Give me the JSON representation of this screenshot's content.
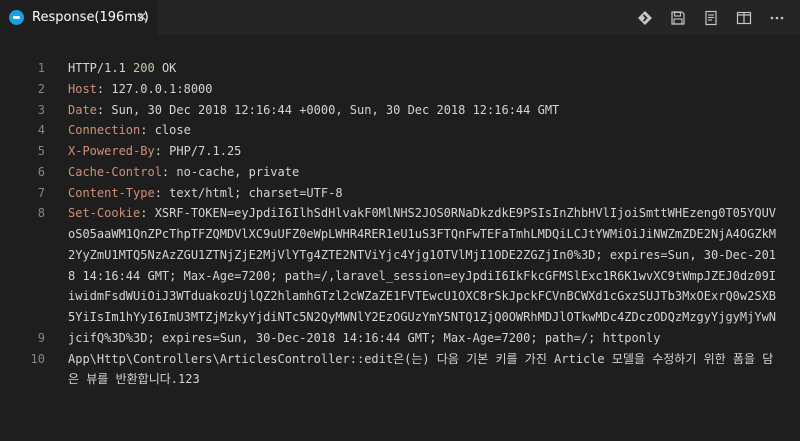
{
  "tab": {
    "title": "Response(196ms)",
    "close_glyph": "×",
    "icon": "rest-client-icon"
  },
  "toolbar": {
    "icons": [
      "diff-icon",
      "save-icon",
      "preview-icon",
      "split-editor-icon",
      "more-icon"
    ]
  },
  "lines": [
    {
      "n": "1",
      "parts": [
        {
          "t": "HTTP/1.1 "
        },
        {
          "t": "200",
          "c": "num"
        },
        {
          "t": " OK"
        }
      ]
    },
    {
      "n": "2",
      "parts": [
        {
          "t": "Host",
          "c": "hkey"
        },
        {
          "t": ": 127.0.0.1:8000"
        }
      ]
    },
    {
      "n": "3",
      "parts": [
        {
          "t": "Date",
          "c": "hkey"
        },
        {
          "t": ": Sun, 30 Dec 2018 12:16:44 +0000, Sun, 30 Dec 2018 12:16:44 GMT"
        }
      ]
    },
    {
      "n": "4",
      "parts": [
        {
          "t": "Connection",
          "c": "hkey"
        },
        {
          "t": ": close"
        }
      ]
    },
    {
      "n": "5",
      "parts": [
        {
          "t": "X-Powered-By",
          "c": "hkey"
        },
        {
          "t": ": PHP/7.1.25"
        }
      ]
    },
    {
      "n": "6",
      "parts": [
        {
          "t": "Cache-Control",
          "c": "hkey"
        },
        {
          "t": ": no-cache, private"
        }
      ]
    },
    {
      "n": "7",
      "parts": [
        {
          "t": "Content-Type",
          "c": "hkey"
        },
        {
          "t": ": text/html; charset=UTF-8"
        }
      ]
    },
    {
      "n": "8",
      "rows": 6,
      "parts": [
        {
          "t": "Set-Cookie",
          "c": "hkey"
        },
        {
          "t": ": XSRF-TOKEN=eyJpdiI6IlhSdHlvakF0MlNHS2JOS0RNaDkzdkE9PSIsInZhbHVlIjoiSmttWHEzeng0T05YQUVoS05aaWM1QnZPcThpTFZQMDVlXC9uUFZ0eWpLWHR4RER1eU1uS3FTQnFwTEFaTmhLMDQiLCJtYWMiOiJiNWZmZDE2NjA4OGZkM2YyZmU1MTQ5NzAzZGU1ZTNjZjE2MjVlYTg4ZTE2NTViYjc4Yjg1OTVlMjI1ODE2ZGZjIn0%3D; expires=Sun, 30-Dec-2018 14:16:44 GMT; Max-Age=7200; path=/,laravel_session=eyJpdiI6IkFkcGFMSlExc1R6K1wvXC9tWmpJZEJ0dz09IiwidmFsdWUiOiJ3WTduakozUjlQZ2hlamhGTzl2cWZaZE1FVTEwcU1OXC8rSkJpckFCVnBCWXd1cGxzSUJTb3MxOExrQ0w2SXB5YiIsIm1hYyI6ImU3MTZjMzkyYjdiNTc5N2QyMWNlY2EzOGUzYmY5NTQ1ZjQ0OWRhMDJlOTkwMDc4ZDczODQzMzgyYjgyMjYwNjcifQ%3D%3D; expires=Sun, 30-Dec-2018 14:16:44 GMT; Max-Age=7200; path=/; httponly"
        }
      ]
    },
    {
      "n": "9",
      "parts": [
        {
          "t": ""
        }
      ]
    },
    {
      "n": "10",
      "rows": 2,
      "parts": [
        {
          "t": "App\\Http\\Controllers\\ArticlesController::edit은(는) 다음 기본 키를 가진 Article 모델을 수정하기 위한 폼을 담은 뷰를 반환합니다.123"
        }
      ]
    }
  ]
}
